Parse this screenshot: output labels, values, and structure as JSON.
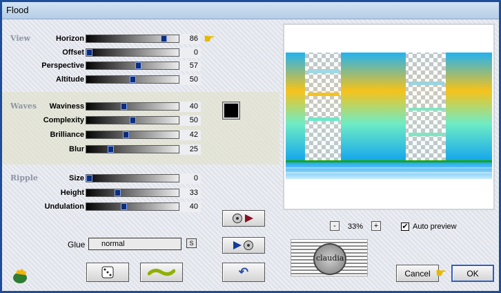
{
  "window": {
    "title": "Flood"
  },
  "sections": {
    "view": "View",
    "waves": "Waves",
    "ripple": "Ripple"
  },
  "sliders": {
    "horizon": {
      "label": "Horizon",
      "value": 86
    },
    "offset": {
      "label": "Offset",
      "value": 0
    },
    "perspective": {
      "label": "Perspective",
      "value": 57
    },
    "altitude": {
      "label": "Altitude",
      "value": 50
    },
    "waviness": {
      "label": "Waviness",
      "value": 40
    },
    "complexity": {
      "label": "Complexity",
      "value": 50
    },
    "brilliance": {
      "label": "Brilliance",
      "value": 42
    },
    "blur": {
      "label": "Blur",
      "value": 25
    },
    "size": {
      "label": "Size",
      "value": 0
    },
    "height": {
      "label": "Height",
      "value": 33
    },
    "undulation": {
      "label": "Undulation",
      "value": 40
    }
  },
  "glue": {
    "label": "Glue",
    "value": "normal",
    "s_button": "S"
  },
  "colors": {
    "wave_color": "#000000"
  },
  "zoom": {
    "minus": "-",
    "value": "33%",
    "plus": "+"
  },
  "auto_preview": {
    "label": "Auto preview",
    "checked": true,
    "mark": "✔"
  },
  "buttons": {
    "cancel": "Cancel",
    "ok": "OK"
  },
  "logo": {
    "text": "claudia"
  }
}
